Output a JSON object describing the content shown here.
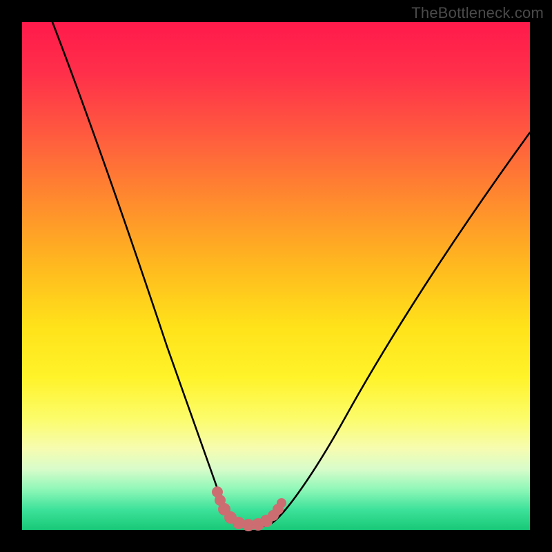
{
  "watermark": {
    "text": "TheBottleneck.com"
  },
  "colors": {
    "frame": "#000000",
    "curve": "#000000",
    "marker": "#cc6d72",
    "gradient_stops": [
      "#ff1a4b",
      "#ff2f4a",
      "#ff5a3f",
      "#ff8a2e",
      "#ffb91f",
      "#ffe21a",
      "#fff32a",
      "#fcfc6a",
      "#f6fcb0",
      "#d8fcca",
      "#8ff7b8",
      "#3de29a",
      "#18c877"
    ]
  },
  "chart_data": {
    "type": "line",
    "title": "",
    "xlabel": "",
    "ylabel": "",
    "xlim": [
      0,
      100
    ],
    "ylim": [
      0,
      100
    ],
    "grid": false,
    "legend": false,
    "note": "Axes are unlabeled in the source image; values below are estimated from pixel positions on a 0–100 normalized scale, y increasing upward.",
    "series": [
      {
        "name": "black-v-curve",
        "stroke": "#000000",
        "x": [
          6,
          10,
          15,
          20,
          25,
          30,
          35,
          38,
          40,
          42,
          45,
          48,
          50,
          55,
          60,
          65,
          70,
          75,
          80,
          85,
          90,
          95,
          100
        ],
        "y": [
          100,
          88,
          75,
          62,
          49,
          36,
          22,
          13,
          7,
          3,
          1,
          1,
          2,
          6,
          13,
          21,
          29,
          37,
          46,
          54,
          62,
          70,
          78
        ]
      },
      {
        "name": "pink-bottom-markers",
        "stroke": "#cc6d72",
        "marker": "circle",
        "x": [
          38,
          39,
          40,
          42,
          44,
          46,
          48,
          49,
          50
        ],
        "y": [
          8,
          5,
          3,
          1.5,
          1,
          1,
          1.5,
          2.5,
          4
        ]
      }
    ]
  }
}
